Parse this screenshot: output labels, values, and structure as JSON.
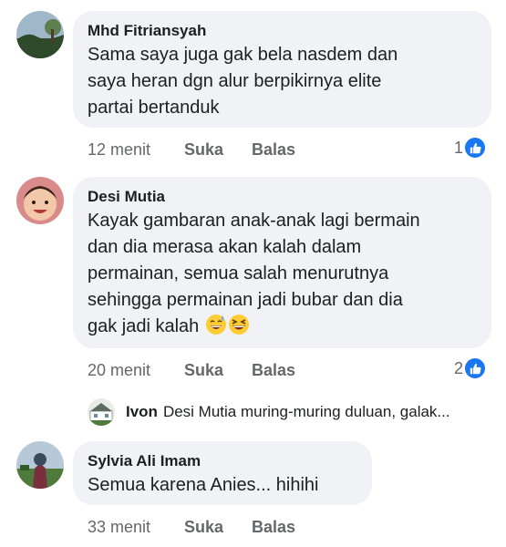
{
  "comments": [
    {
      "author": "Mhd Fitriansyah",
      "text": "Sama saya juga gak bela nasdem dan\nsaya heran dgn alur berpikirnya elite\npartai bertanduk",
      "time": "12 menit",
      "like_label": "Suka",
      "reply_label": "Balas",
      "reaction_count": "1"
    },
    {
      "author": "Desi Mutia",
      "text": "Kayak gambaran anak-anak lagi bermain\ndan dia merasa akan kalah dalam\npermainan, semua salah menurutnya\nsehingga permainan jadi bubar dan dia\ngak jadi kalah",
      "emojis": [
        "grinning-sweat-emoji",
        "laughing-squint-emoji"
      ],
      "time": "20 menit",
      "like_label": "Suka",
      "reply_label": "Balas",
      "reaction_count": "2",
      "reply_preview": {
        "author": "Ivon",
        "text": "Desi Mutia muring-muring duluan, galak..."
      }
    },
    {
      "author": "Sylvia Ali Imam",
      "text": "Semua karena Anies... hihihi",
      "time": "33 menit",
      "like_label": "Suka",
      "reply_label": "Balas"
    }
  ],
  "colors": {
    "bubble": "#f0f2f5",
    "text": "#1c1e21",
    "meta": "#65676b",
    "like_blue": "#1877f2"
  }
}
